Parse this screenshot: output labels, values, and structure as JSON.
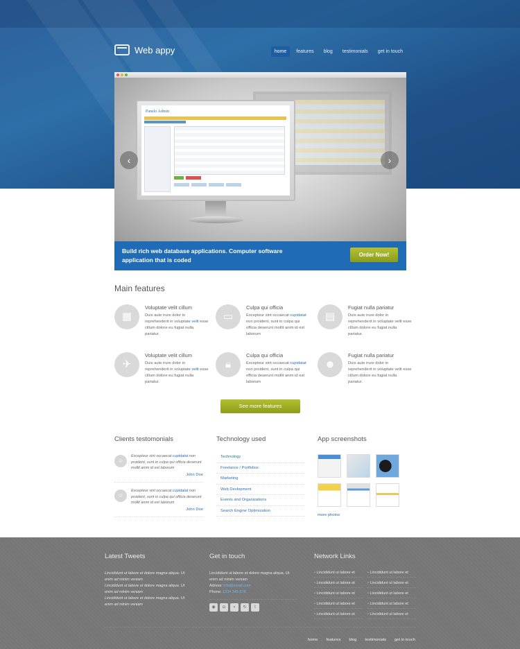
{
  "header": {
    "logo_text": "Web appy",
    "nav": [
      {
        "label": "home",
        "active": true
      },
      {
        "label": "features",
        "active": false
      },
      {
        "label": "blog",
        "active": false
      },
      {
        "label": "testimonials",
        "active": false
      },
      {
        "label": "get in touch",
        "active": false
      }
    ]
  },
  "slider": {
    "screen_title": "Panelo Admin",
    "caption": "Build rich web database applications. Computer software application that is coded",
    "cta_label": "Order Now!",
    "prev_icon": "chevron-left-icon",
    "next_icon": "chevron-right-icon"
  },
  "features": {
    "heading": "Main features",
    "items": [
      {
        "title": "Voluptate velit cillum",
        "desc_a": "Duis aute irure dolor in reprehenderit in voluptate ",
        "desc_link": "velit",
        "desc_b": " esse cillum dolore eu fugiat nulla pariatur.",
        "icon": "presentation-icon"
      },
      {
        "title": "Culpa qui officia",
        "desc_a": "Excepteur sint occaecat ",
        "desc_link": "cupidatat",
        "desc_b": " non proident, sunt in culpa qui officia deserunt mollit anim id est laborum",
        "icon": "video-camera-icon"
      },
      {
        "title": "Fugiat nulla pariatur",
        "desc_a": "Duis aute irure dolor in reprehenderit in voluptate velit esse cillum dolore eu fugiat nulla pariatur.",
        "desc_link": "",
        "desc_b": "",
        "icon": "documents-icon"
      },
      {
        "title": "Voluptate velit cillum",
        "desc_a": "Duis aute irure dolor in reprehenderit in voluptate ",
        "desc_link": "velit",
        "desc_b": " esse cillum dolore eu fugiat nulla pariatur.",
        "icon": "twitter-bird-icon"
      },
      {
        "title": "Culpa qui officia",
        "desc_a": "Excepteur sint occaecat ",
        "desc_link": "cupidatat",
        "desc_b": " non proident, sunt in culpa qui officia deserunt mollit anim id est laborum",
        "icon": "lock-icon"
      },
      {
        "title": "Fugiat nulla pariatur",
        "desc_a": "Duis aute irure dolor in reprehenderit in voluptate velit esse cillum dolore eu fugiat nulla pariatur.",
        "desc_link": "",
        "desc_b": "",
        "icon": "users-icon"
      }
    ],
    "more_label": "See more features"
  },
  "testimonials": {
    "heading": "Clients testomonials",
    "items": [
      {
        "quote_a": "Excepteur sint occaecat ",
        "quote_link": "cupidatat",
        "quote_b": " non proident, sunt in culpa qui officia deserunt mollit anim id est laborum",
        "author": "John Doe"
      },
      {
        "quote_a": "Excepteur sint occaecat ",
        "quote_link": "cupidatat",
        "quote_b": " non proident, sunt in culpa qui officia deserunt mollit anim id est laborum",
        "author": "John Doe"
      }
    ]
  },
  "technology": {
    "heading": "Technology used",
    "items": [
      "Technology",
      "Freelance / Portfolios",
      "Marketing",
      "Web Devlopment",
      "Events and Organizations",
      "Search Engine Optimization"
    ]
  },
  "screenshots": {
    "heading": "App screenshots",
    "more_label": "more photos"
  },
  "footer": {
    "tweets_heading": "Latest Tweets",
    "tweets": [
      "Lincididunt ut labore et dolore magna aliqua. Ut enim ad minim veniam",
      "Lincididunt ut labore et dolore magna aliqua. Ut enim ad minim veniam",
      "Lincididunt ut labore et dolore magna aliqua. Ut enim ad minim veniam"
    ],
    "contact_heading": "Get in touch",
    "contact_text": "Lincididunt ut labore et dolore magna aliqua. Ut enim ad minim veniam",
    "address_label": "Adress:",
    "address_value": "info@email.com",
    "phone_label": "Phone:",
    "phone_value": "1234 345 678",
    "social_icons": [
      "rss-icon",
      "camera-icon",
      "flickr-icon",
      "share-icon",
      "twitter-icon"
    ],
    "network_heading": "Network Links",
    "network_links": [
      "Lincididunt ut labore et",
      "Lincididunt ut labore et",
      "Lincididunt ut labore et",
      "Lincididunt ut labore et",
      "Lincididunt ut labore et",
      "Lincididunt ut labore et",
      "Lincididunt ut labore et",
      "Lincididunt ut labore et",
      "Lincididunt ut labore et",
      "Lincididunt ut labore et"
    ],
    "nav": [
      "home",
      "features",
      "blog",
      "testimonials",
      "get in touch"
    ]
  }
}
